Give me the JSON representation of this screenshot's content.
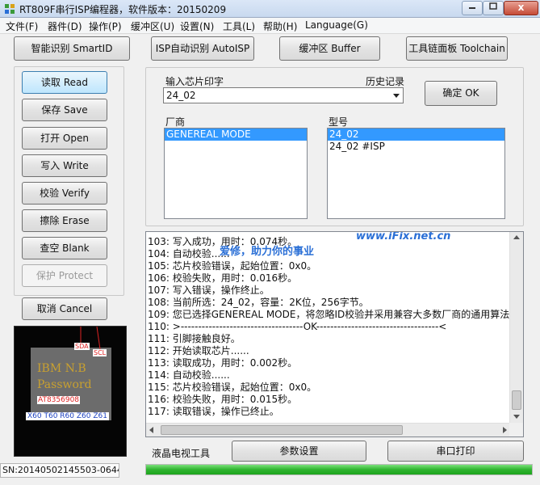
{
  "window": {
    "title": "RT809F串行ISP编程器，软件版本：20150209",
    "minimize_icon": "minimize-icon",
    "maximize_icon": "maximize-icon",
    "close_icon": "close-icon",
    "close_symbol": "x"
  },
  "menu": [
    "文件(F)",
    "器件(D)",
    "操作(P)",
    "缓冲区(U)",
    "设置(N)",
    "工具(L)",
    "帮助(H)",
    "Language(G)"
  ],
  "toolbar": {
    "smartid": "智能识别 SmartID",
    "autoisp": "ISP自动识别 AutoISP",
    "buffer": "缓冲区 Buffer",
    "toolchain": "工具链面板 Toolchain"
  },
  "ops": {
    "read": "读取 Read",
    "save": "保存 Save",
    "open": "打开 Open",
    "write": "写入 Write",
    "verify": "校验 Verify",
    "erase": "擦除 Erase",
    "blank": "查空 Blank",
    "protect": "保护 Protect",
    "cancel": "取消 Cancel"
  },
  "chip_select": {
    "input_label": "输入芯片印字",
    "history_label": "历史记录",
    "input_value": "24_02",
    "ok_button": "确定 OK",
    "vendor_label": "厂商",
    "vendors": [
      "GENEREAL MODE"
    ],
    "model_label": "型号",
    "models": [
      "24_02",
      "24_02 #ISP"
    ]
  },
  "log_lines": [
    "103: 写入成功，用时：0.074秒。",
    "104: 自动校验......",
    "105: 芯片校验错误，起始位置：0x0。",
    "106: 校验失败，用时：0.016秒。",
    "107: 写入错误，操作终止。",
    "108: 当前所选：24_02，容量：2K位，256字节。",
    "109: 您已选择GENEREAL MODE，将忽略ID校验并采用兼容大多数厂商的通用算法。",
    "110: >-----------------------------------OK-----------------------------------<",
    "111: 引脚接触良好。",
    "112: 开始读取芯片......",
    "113: 读取成功，用时：0.002秒。",
    "114: 自动校验......",
    "115: 芯片校验错误，起始位置：0x0。",
    "116: 校验失败，用时：0.015秒。",
    "117: 读取错误，操作已终止。"
  ],
  "watermark": {
    "url": "www.iFix.net.cn",
    "slogan": "爱修，助力你的事业"
  },
  "bottom": {
    "lcd_label": "液晶电视工具",
    "settings_button": "参数设置",
    "print_button": "串口打印",
    "progress": 1.0,
    "status_sn": "SN:20140502145503-0644"
  },
  "chip_image": {
    "sda": "SDA",
    "scl": "SCL",
    "line1": "IBM N.B",
    "line2": "Password",
    "part": "AT8356908",
    "pins": "X60 T60 R60 Z60 Z61"
  },
  "colors": {
    "accent": "#3399ff",
    "progress": "#2fb42f",
    "watermark": "#2a6fd6"
  }
}
